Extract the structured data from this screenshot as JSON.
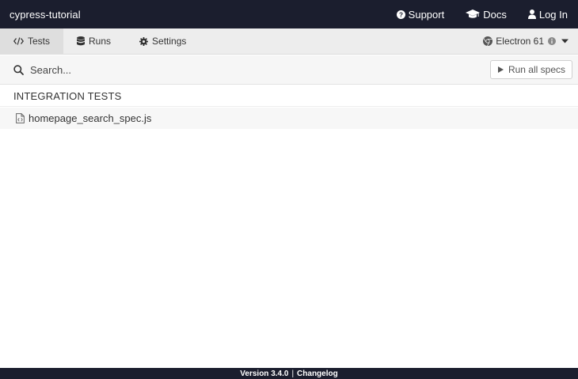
{
  "header": {
    "project_name": "cypress-tutorial",
    "links": [
      {
        "label": "Support",
        "icon": "question-circle-icon"
      },
      {
        "label": "Docs",
        "icon": "graduation-cap-icon"
      },
      {
        "label": "Log In",
        "icon": "user-icon"
      }
    ]
  },
  "nav": {
    "tabs": [
      {
        "label": "Tests",
        "icon": "code-icon",
        "active": true
      },
      {
        "label": "Runs",
        "icon": "database-icon",
        "active": false
      },
      {
        "label": "Settings",
        "icon": "cog-icon",
        "active": false
      }
    ],
    "browser": {
      "label": "Electron 61",
      "icon": "chrome-icon"
    }
  },
  "search": {
    "placeholder": "Search...",
    "run_all_label": "Run all specs"
  },
  "specs": {
    "section_title": "INTEGRATION TESTS",
    "files": [
      {
        "name": "homepage_search_spec.js"
      }
    ]
  },
  "footer": {
    "version": "Version 3.4.0",
    "separator": "|",
    "changelog": "Changelog"
  },
  "colors": {
    "topbar_bg": "#1b1e2e",
    "navbar_bg": "#ededed",
    "active_tab_bg": "#dedede"
  }
}
